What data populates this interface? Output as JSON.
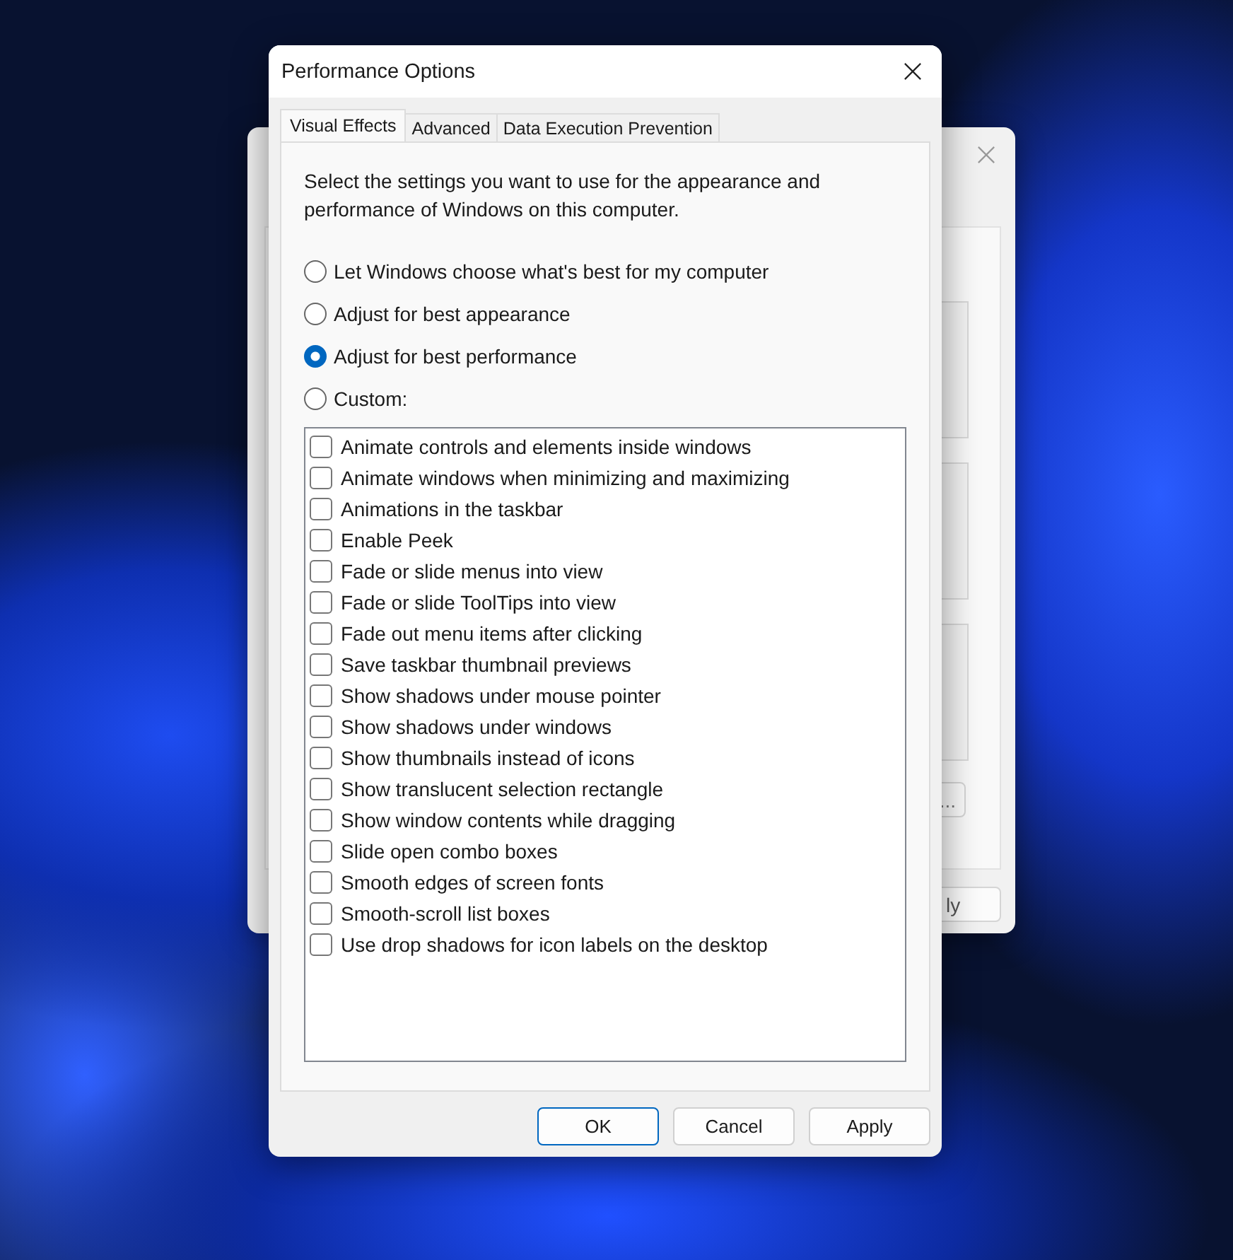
{
  "background_window": {
    "browse_button": "...",
    "apply_button": "ly"
  },
  "dialog": {
    "title": "Performance Options"
  },
  "tabs": [
    {
      "label": "Visual Effects",
      "selected": true
    },
    {
      "label": "Advanced",
      "selected": false
    },
    {
      "label": "Data Execution Prevention",
      "selected": false
    }
  ],
  "description": "Select the settings you want to use for the appearance and performance of Windows on this computer.",
  "options": [
    {
      "label": "Let Windows choose what's best for my computer",
      "selected": false
    },
    {
      "label": "Adjust for best appearance",
      "selected": false
    },
    {
      "label": "Adjust for best performance",
      "selected": true
    },
    {
      "label": "Custom:",
      "selected": false
    }
  ],
  "effects": [
    {
      "label": "Animate controls and elements inside windows",
      "checked": false
    },
    {
      "label": "Animate windows when minimizing and maximizing",
      "checked": false
    },
    {
      "label": "Animations in the taskbar",
      "checked": false
    },
    {
      "label": "Enable Peek",
      "checked": false
    },
    {
      "label": "Fade or slide menus into view",
      "checked": false
    },
    {
      "label": "Fade or slide ToolTips into view",
      "checked": false
    },
    {
      "label": "Fade out menu items after clicking",
      "checked": false
    },
    {
      "label": "Save taskbar thumbnail previews",
      "checked": false
    },
    {
      "label": "Show shadows under mouse pointer",
      "checked": false
    },
    {
      "label": "Show shadows under windows",
      "checked": false
    },
    {
      "label": "Show thumbnails instead of icons",
      "checked": false
    },
    {
      "label": "Show translucent selection rectangle",
      "checked": false
    },
    {
      "label": "Show window contents while dragging",
      "checked": false
    },
    {
      "label": "Slide open combo boxes",
      "checked": false
    },
    {
      "label": "Smooth edges of screen fonts",
      "checked": false
    },
    {
      "label": "Smooth-scroll list boxes",
      "checked": false
    },
    {
      "label": "Use drop shadows for icon labels on the desktop",
      "checked": false
    }
  ],
  "buttons": [
    {
      "label": "OK",
      "default": true
    },
    {
      "label": "Cancel",
      "default": false
    },
    {
      "label": "Apply",
      "default": false
    }
  ]
}
